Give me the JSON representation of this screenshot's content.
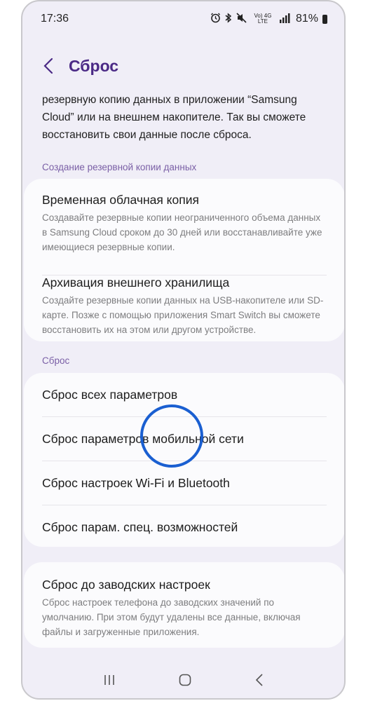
{
  "status_bar": {
    "time": "17:36",
    "lte_label": "Vo) 4G LTE",
    "battery_percent": "81%",
    "icons": [
      "alarm-icon",
      "bluetooth-icon",
      "mute-icon",
      "lte-icon",
      "signal-icon",
      "battery-icon"
    ]
  },
  "header": {
    "title": "Сброс"
  },
  "intro_text": "резервную копию данных в приложении “Samsung Cloud” или на внешнем накопителе. Так вы сможете восстановить свои данные после сброса.",
  "backup_section": {
    "label": "Создание резервной копии данных",
    "items": [
      {
        "title": "Временная облачная копия",
        "description": "Создавайте резервные копии неограниченного объема данных в Samsung Cloud сроком до 30 дней или восстанавливайте уже имеющиеся резервные копии."
      },
      {
        "title": "Архивация внешнего хранилища",
        "description": "Создайте резервные копии данных на USB-накопителе или SD-карте. Позже с помощью приложения Smart Switch вы сможете восстановить их на этом или другом устройстве."
      }
    ]
  },
  "reset_section": {
    "label": "Сброс",
    "items": [
      {
        "title": "Сброс всех параметров"
      },
      {
        "title": "Сброс параметров мобильной сети"
      },
      {
        "title": "Сброс настроек Wi-Fi и Bluetooth"
      },
      {
        "title": "Сброс парам. спец. возможностей"
      }
    ]
  },
  "factory_reset": {
    "title": "Сброс до заводских настроек",
    "description": "Сброс настроек телефона до заводских значений по умолчанию. При этом будут удалены все данные, включая файлы и загруженные приложения."
  },
  "colors": {
    "accent": "#4b2a86",
    "section_label": "#7a5fa6",
    "touch_indicator": "#1a5fd1"
  }
}
